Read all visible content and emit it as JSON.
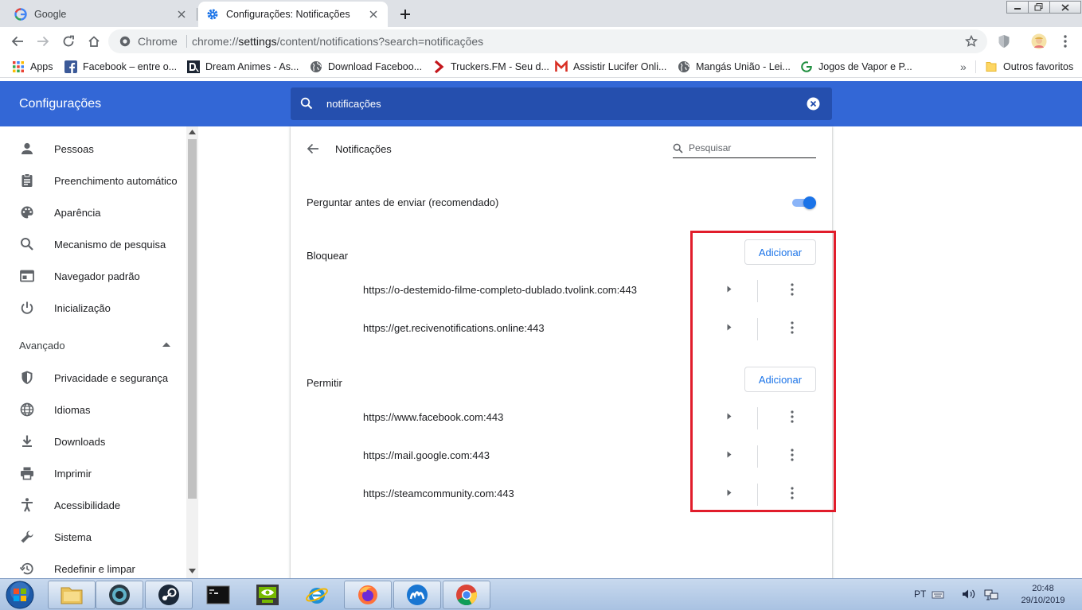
{
  "browser": {
    "tabs": [
      {
        "title": "Google",
        "favicon": "google-g-icon",
        "active": false
      },
      {
        "title": "Configurações: Notificações",
        "favicon": "settings-gear-icon",
        "active": true
      }
    ],
    "site_label": "Chrome",
    "url_scheme": "chrome://",
    "url_host": "settings",
    "url_path": "/content/notifications?search=notificações"
  },
  "bookmarks": [
    {
      "label": "Apps",
      "icon": "apps-grid-icon"
    },
    {
      "label": "Facebook – entre o...",
      "icon": "facebook-icon"
    },
    {
      "label": "Dream Animes - As...",
      "icon": "dream-animes-icon"
    },
    {
      "label": "Download Faceboo...",
      "icon": "globe-icon"
    },
    {
      "label": "Truckers.FM - Seu d...",
      "icon": "truckersfm-icon"
    },
    {
      "label": "Assistir Lucifer Onli...",
      "icon": "m-red-icon"
    },
    {
      "label": "Mangás União - Lei...",
      "icon": "globe-icon"
    },
    {
      "label": "Jogos de Vapor e P...",
      "icon": "g-green-icon"
    }
  ],
  "bookmarks_overflow": "»",
  "other_bookmarks": "Outros favoritos",
  "settings": {
    "title": "Configurações",
    "search_value": "notificações"
  },
  "sidebar": {
    "items": [
      {
        "label": "Pessoas",
        "icon": "person-icon"
      },
      {
        "label": "Preenchimento automático",
        "icon": "clipboard-icon"
      },
      {
        "label": "Aparência",
        "icon": "palette-icon"
      },
      {
        "label": "Mecanismo de pesquisa",
        "icon": "search-icon"
      },
      {
        "label": "Navegador padrão",
        "icon": "browser-window-icon"
      },
      {
        "label": "Inicialização",
        "icon": "power-icon"
      }
    ],
    "advanced_label": "Avançado",
    "advanced_items": [
      {
        "label": "Privacidade e segurança",
        "icon": "shield-icon"
      },
      {
        "label": "Idiomas",
        "icon": "globe-icon"
      },
      {
        "label": "Downloads",
        "icon": "download-icon"
      },
      {
        "label": "Imprimir",
        "icon": "printer-icon"
      },
      {
        "label": "Acessibilidade",
        "icon": "accessibility-icon"
      },
      {
        "label": "Sistema",
        "icon": "wrench-icon"
      },
      {
        "label": "Redefinir e limpar",
        "icon": "restore-icon"
      }
    ]
  },
  "page": {
    "title": "Notificações",
    "search_placeholder": "Pesquisar",
    "ask_before_sending": "Perguntar antes de enviar (recomendado)",
    "ask_toggle_on": true,
    "block": {
      "label": "Bloquear",
      "add_label": "Adicionar",
      "sites": [
        "https://o-destemido-filme-completo-dublado.tvolink.com:443",
        "https://get.recivenotifications.online:443"
      ]
    },
    "allow": {
      "label": "Permitir",
      "add_label": "Adicionar",
      "sites": [
        "https://www.facebook.com:443",
        "https://mail.google.com:443",
        "https://steamcommunity.com:443"
      ]
    }
  },
  "taskbar": {
    "language": "PT",
    "time": "20:48",
    "date": "29/10/2019"
  },
  "colors": {
    "header_blue": "#3367d6",
    "search_blue": "#254fae",
    "accent": "#1a73e8",
    "highlight_red": "#e11d2b"
  }
}
